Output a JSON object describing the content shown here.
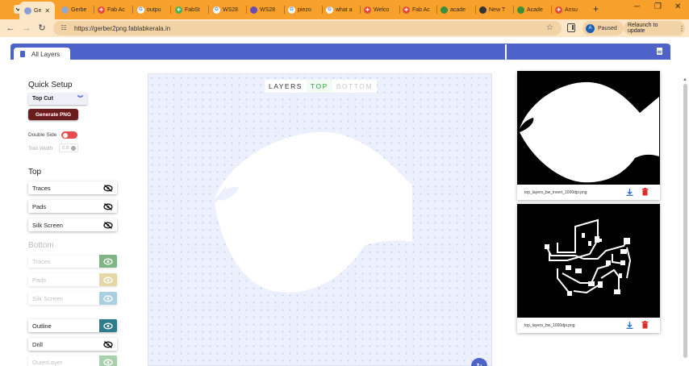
{
  "browser": {
    "tabs": [
      {
        "label": "Ge",
        "active": true
      },
      {
        "label": "Gerbe"
      },
      {
        "label": "Fab Ac"
      },
      {
        "label": "outpu"
      },
      {
        "label": "FabSt"
      },
      {
        "label": "WS28"
      },
      {
        "label": "WS28"
      },
      {
        "label": "piezo"
      },
      {
        "label": "what a"
      },
      {
        "label": "Welco"
      },
      {
        "label": "Fab Ac"
      },
      {
        "label": "acade"
      },
      {
        "label": "New T"
      },
      {
        "label": "Acade"
      },
      {
        "label": "Ansu"
      }
    ],
    "url": "https://gerber2png.fablabkerala.in",
    "profile_initial": "A",
    "profile_status": "Paused",
    "relaunch_label": "Relaunch to update"
  },
  "app": {
    "tab_label": "All Layers",
    "quick_setup": {
      "heading": "Quick Setup",
      "preset_value": "Top Cut",
      "generate_label": "Generate PNG",
      "double_side_label": "Double Side",
      "tool_width_label": "Tool Width",
      "tool_width_value": "0.8"
    },
    "top_section": {
      "heading": "Top",
      "layers": [
        "Traces",
        "Pads",
        "Silk Screen"
      ]
    },
    "bottom_section": {
      "heading": "Bottom",
      "layers": [
        "Traces",
        "Pads",
        "Silk Screen"
      ]
    },
    "other_layers": [
      "Outline",
      "Drill",
      "OuterLayer"
    ],
    "view_switch": {
      "layers": "LAYERS",
      "top": "TOP",
      "bottom": "BOTTOM"
    },
    "previews": [
      {
        "filename": "top_layers_bw_invert_1000dpi.png"
      },
      {
        "filename": "top_layers_bw_1000dpi.png"
      }
    ],
    "colors": {
      "accent": "#4e63c9",
      "generate_button": "#6b1d1d",
      "toggle_off": "#e94e4e",
      "eye_bottom_traces": "#7fb585",
      "eye_bottom_pads": "#e3d8a6",
      "eye_bottom_silk": "#a9cfe0",
      "eye_outline": "#2e7d8c",
      "eye_outer": "#a8d0ac",
      "delete_icon": "#e02b2b"
    }
  }
}
